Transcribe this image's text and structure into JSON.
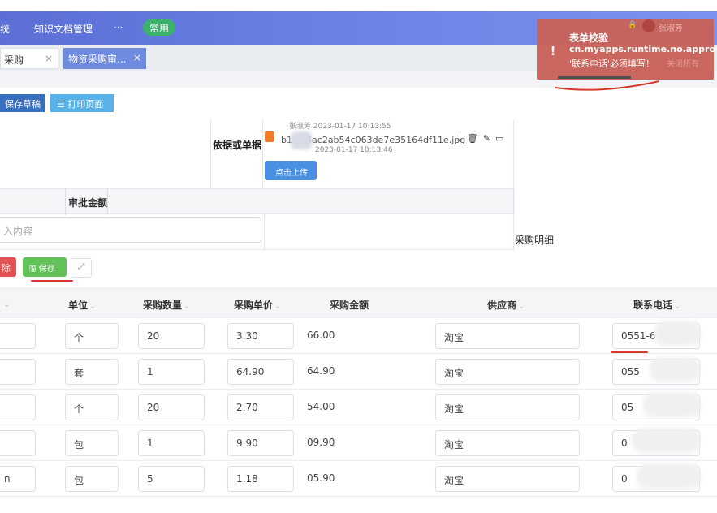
{
  "nav": {
    "system_partial": "统",
    "knowledge": "知识文档管理",
    "more": "···",
    "common": "常用"
  },
  "tabs": [
    {
      "label": "采购",
      "close": "×"
    },
    {
      "label": "物资采购审...",
      "close": "×"
    }
  ],
  "toolbar": {
    "save_draft": "保存草稿",
    "print": "☰ 打印页面"
  },
  "form": {
    "basis_label": "依据或单据",
    "file": {
      "uploader_meta": "张淑芳  2023-01-17 10:13:55",
      "name": "b1c…4ac2ab54c063de7e35164df11e.jpg",
      "time": "2023-01-17 10:13:46",
      "actions": "⤓🗑✎▭"
    },
    "upload_button": "点击上传",
    "approve_amount_label": "审批金额",
    "approve_input_placeholder": "入内容",
    "purchase_detail_label": "采购明细"
  },
  "detail_toolbar": {
    "delete": "除",
    "save": "🖫 保存",
    "expand": "⤢"
  },
  "table": {
    "headers": {
      "col0": "",
      "unit": "单位",
      "qty": "采购数量",
      "price": "采购单价",
      "amount": "采购金额",
      "supplier": "供应商",
      "phone": "联系电话"
    },
    "rows": [
      {
        "name": "",
        "unit": "个",
        "qty": "20",
        "price": "3.30",
        "amount": "66.00",
        "supplier": "淘宝",
        "phone": "0551-6"
      },
      {
        "name": "",
        "unit": "套",
        "qty": "1",
        "price": "64.90",
        "amount": "64.90",
        "supplier": "淘宝",
        "phone": "055"
      },
      {
        "name": "",
        "unit": "个",
        "qty": "20",
        "price": "2.70",
        "amount": "54.00",
        "supplier": "淘宝",
        "phone": "05"
      },
      {
        "name": "",
        "unit": "包",
        "qty": "1",
        "price": "9.90",
        "amount": "09.90",
        "supplier": "淘宝",
        "phone": "0"
      },
      {
        "name": "n",
        "unit": "包",
        "qty": "5",
        "price": "1.18",
        "amount": "05.90",
        "supplier": "淘宝",
        "phone": "0"
      }
    ]
  },
  "toast": {
    "title": "表单校验",
    "code": "cn.myapps.runtime.no.approval",
    "message": "'联系电话'必须填写！",
    "icon": "!",
    "bg_user": "张淑芳",
    "bg_closeall": "关闭所有"
  },
  "colors": {
    "nav": "#5b6fd6",
    "toast": "#c8625a",
    "save": "#63c25a",
    "delete": "#e05252",
    "annotation": "#d33a2c"
  }
}
